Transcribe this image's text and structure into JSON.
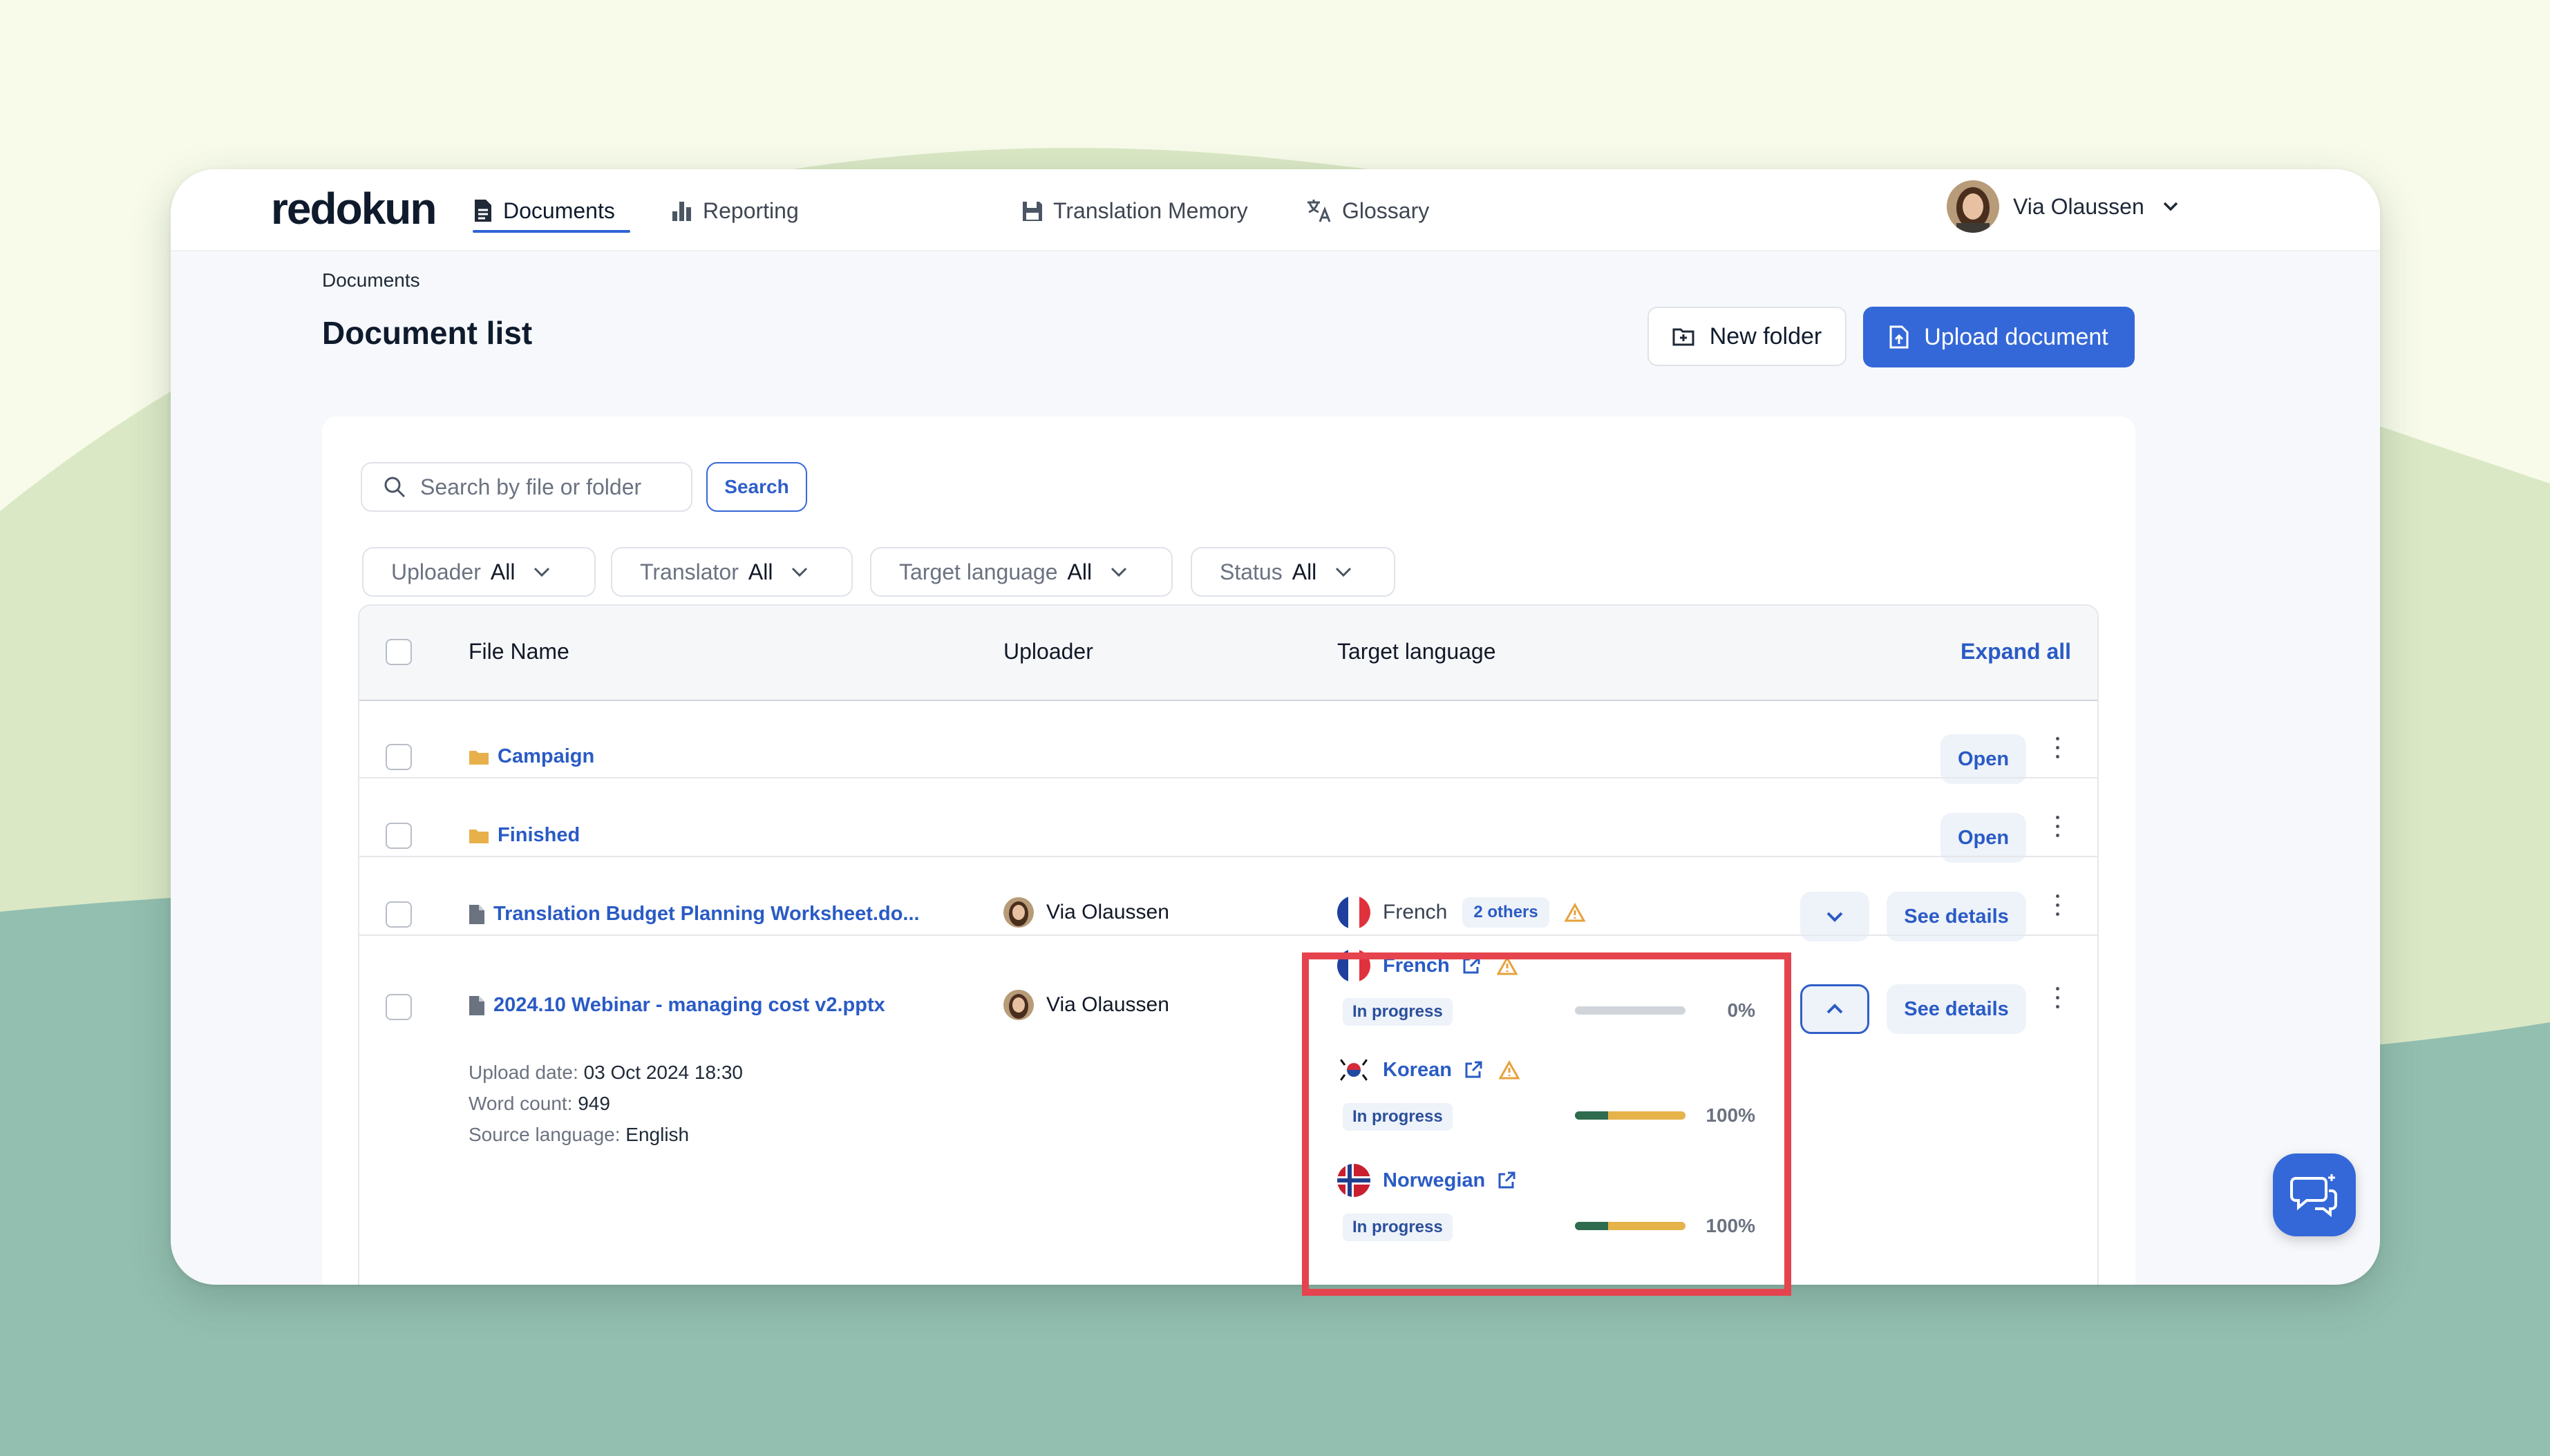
{
  "app": {
    "logo": "redokun"
  },
  "nav": {
    "items": [
      {
        "label": "Documents",
        "icon": "document-icon",
        "active": true
      },
      {
        "label": "Reporting",
        "icon": "bar-chart-icon",
        "active": false
      },
      {
        "label": "Translation Memory",
        "icon": "memory-icon",
        "active": false
      },
      {
        "label": "Glossary",
        "icon": "translate-icon",
        "active": false
      }
    ]
  },
  "user": {
    "name": "Via Olaussen"
  },
  "breadcrumb": "Documents",
  "page_title": "Document list",
  "actions": {
    "new_folder": "New folder",
    "upload": "Upload document"
  },
  "search": {
    "placeholder": "Search by file or folder",
    "button": "Search"
  },
  "filters": [
    {
      "label": "Uploader",
      "value": "All"
    },
    {
      "label": "Translator",
      "value": "All"
    },
    {
      "label": "Target language",
      "value": "All"
    },
    {
      "label": "Status",
      "value": "All"
    }
  ],
  "table": {
    "headers": {
      "file_name": "File Name",
      "uploader": "Uploader",
      "target_language": "Target language",
      "expand_all": "Expand all"
    },
    "rows": [
      {
        "type": "folder",
        "name": "Campaign",
        "action": "Open"
      },
      {
        "type": "folder",
        "name": "Finished",
        "action": "Open"
      },
      {
        "type": "file",
        "name": "Translation Budget Planning Worksheet.do...",
        "uploader": "Via Olaussen",
        "language": "French",
        "others": "2 others",
        "action": "See details"
      },
      {
        "type": "file",
        "name": "2024.10 Webinar - managing cost v2.pptx",
        "uploader": "Via Olaussen",
        "action": "See details",
        "details": {
          "upload_date_label": "Upload date:",
          "upload_date": "03 Oct 2024 18:30",
          "word_count_label": "Word count:",
          "word_count": "949",
          "source_language_label": "Source language:",
          "source_language": "English"
        },
        "languages": [
          {
            "name": "French",
            "status": "In progress",
            "progress_label": "0%",
            "reviewed": 0,
            "translated": 0,
            "warning": true
          },
          {
            "name": "Korean",
            "status": "In progress",
            "progress_label": "100%",
            "reviewed": 0.3,
            "translated": 1.0,
            "warning": true
          },
          {
            "name": "Norwegian",
            "status": "In progress",
            "progress_label": "100%",
            "reviewed": 0.3,
            "translated": 1.0,
            "warning": false
          }
        ]
      }
    ]
  },
  "colors": {
    "accent": "#3468d8",
    "link": "#2a5bc5",
    "highlight": "#e5434d",
    "progress_green": "#2f6b4f",
    "progress_yellow": "#e6b24a"
  }
}
